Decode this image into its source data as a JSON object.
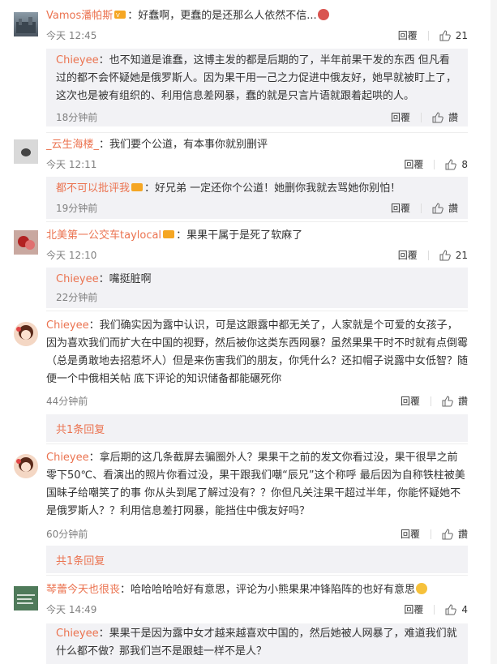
{
  "labels": {
    "reply": "回覆",
    "zan": "讚"
  },
  "comments": [
    {
      "user": "Vamos潘帕斯",
      "text": "：好蠢啊，更蠢的是还那么人依然不信...",
      "time": "今天 12:45",
      "likes": "21",
      "reply": {
        "user": "Chieyee",
        "text": "：也不知道是谁蠢，这博主发的都是后期的了，半年前果干发的东西 但凡看过的都不会怀疑她是俄罗斯人。因为果干用一己之力促进中俄友好，她早就被盯上了，这次也是被有组织的、利用信息差网暴，蠢的就是只言片语就跟着起哄的人。",
        "time": "18分钟前"
      }
    },
    {
      "user": "_云生海楼_",
      "text": "：我们要个公道，有本事你就别删评",
      "time": "今天 12:11",
      "likes": "8",
      "reply": {
        "user": "都不可以批评我",
        "text": "：好兄弟 一定还你个公道！她删你我就去骂她你别怕！",
        "time": "19分钟前"
      }
    },
    {
      "user": "北美第一公交车taylocal",
      "text": "：果果干属于是死了软麻了",
      "time": "今天 12:10",
      "likes": "21",
      "reply": {
        "user": "Chieyee",
        "text": "：嘴挺脏啊",
        "time": "22分钟前"
      }
    },
    {
      "user": "Chieyee",
      "text": "：我们确实因为露中认识，可是这跟露中都无关了，人家就是个可爱的女孩子，因为喜欢我们而扩大在中国的视野，然后被你这类东西网暴？虽然果果干时不时就有点倒霉（总是勇敢地去招惹坏人）但是来伤害我们的朋友，你凭什么？还扣帽子说露中女低智？随便一个中俄相关帖 底下评论的知识储备都能碾死你",
      "time": "44分钟前",
      "likes": "",
      "more": "共1条回复"
    },
    {
      "user": "Chieyee",
      "text": "：拿后期的这几条截屏去骗圈外人？果果干之前的发文你看过没，果干很早之前零下50℃、看演出的照片你看过没，果干跟我们嘲“辰兄”这个称呼 最后因为自称铁柱被美国昧子给嘲笑了的事 你从头到尾了解过没有？？你但凡关注果干超过半年，你能怀疑她不是俄罗斯人？？利用信息差打网暴，能挡住中俄友好吗？",
      "time": "60分钟前",
      "likes": "",
      "more": "共1条回复"
    },
    {
      "user": "琴蕾今天也很丧",
      "text": "：哈哈哈哈哈好有意思，评论为小熊果果冲锋陷阵的也好有意思",
      "time": "今天 14:49",
      "likes": "4",
      "reply": {
        "user": "Chieyee",
        "text": "：果果干是因为露中女才越来越喜欢中国的，然后她被人网暴了，难道我们就什么都不做？那我们岂不是跟蛙一样不是人？",
        "time": ""
      }
    }
  ]
}
